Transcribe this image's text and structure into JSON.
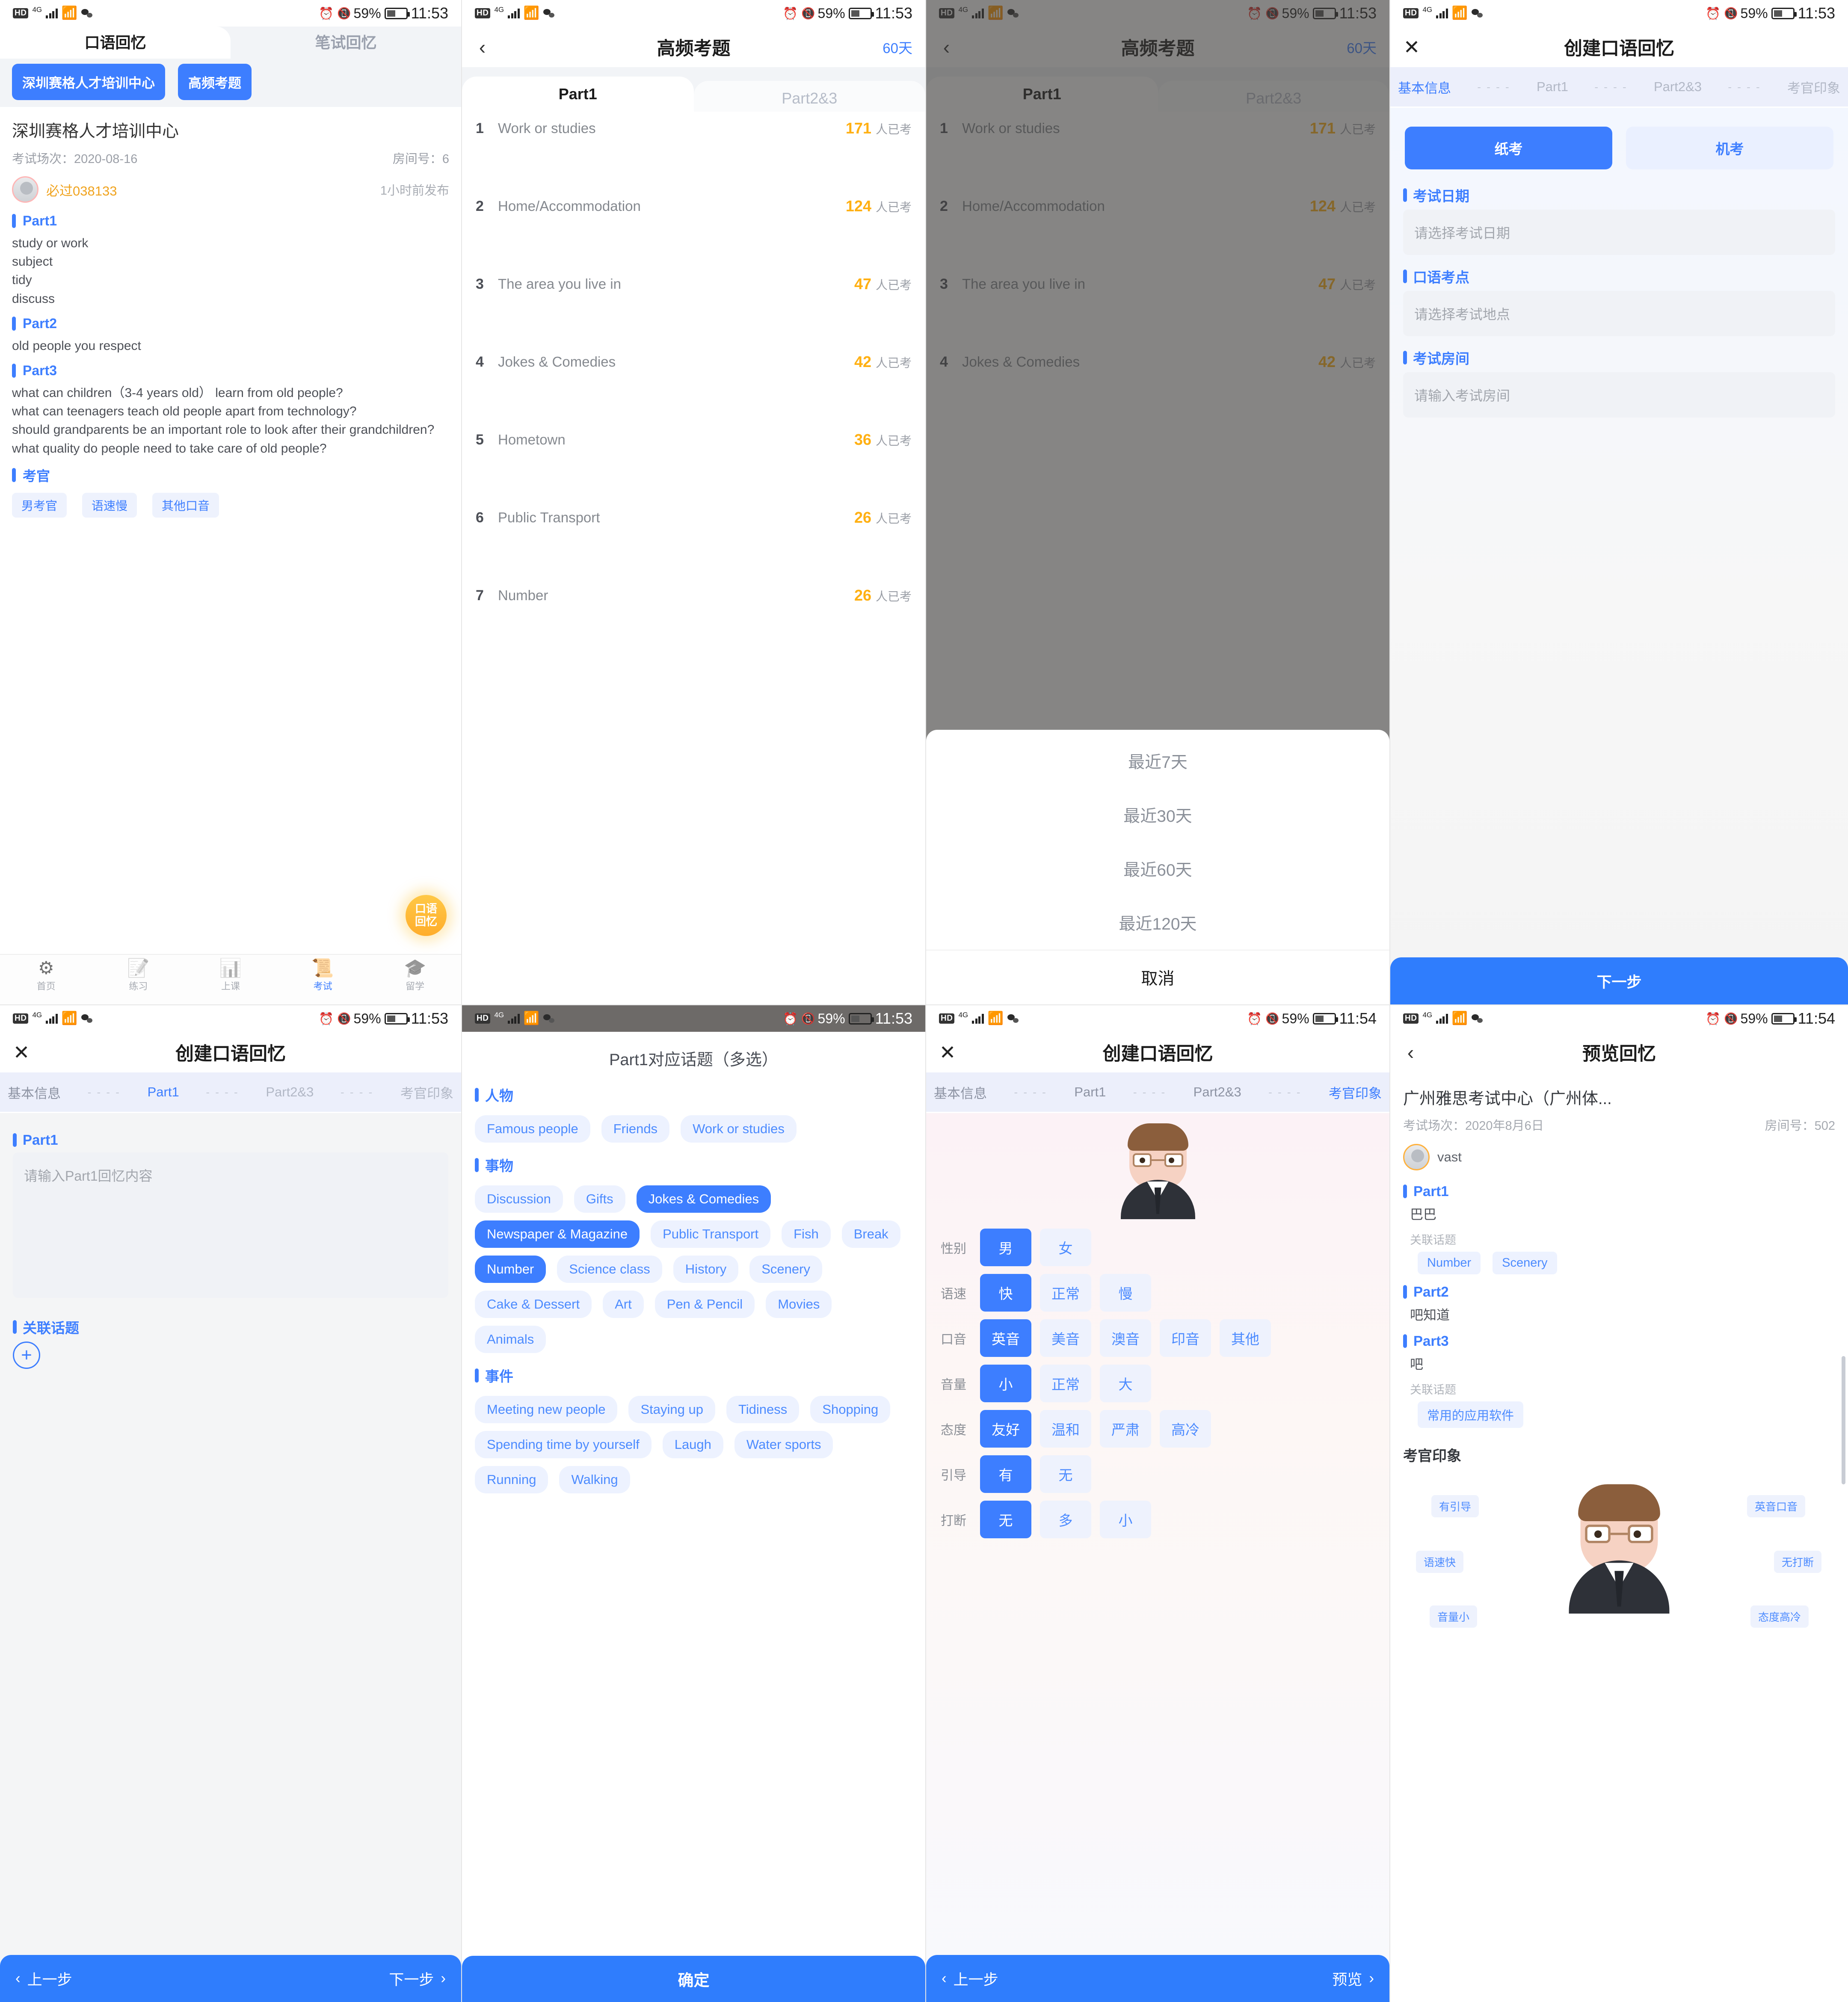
{
  "status_bar": {
    "hd": "HD",
    "net": "4G",
    "battery_pct": "59%",
    "time_1": "11:53",
    "time_2": "11:54"
  },
  "colors": {
    "primary": "#3d7eff",
    "accent_orange": "#ffb013",
    "chip_bg": "#edf2ff"
  },
  "panel1": {
    "tabs": [
      {
        "label": "口语回忆",
        "active": true
      },
      {
        "label": "笔试回忆",
        "active": false
      }
    ],
    "filter_chips": [
      "深圳赛格人才培训中心",
      "高频考题"
    ],
    "org_name": "深圳赛格人才培训中心",
    "exam_session_label": "考试场次：2020-08-16",
    "room_label": "房间号：6",
    "user_name": "必过038133",
    "publish_time": "1小时前发布",
    "sections": [
      {
        "title": "Part1",
        "lines": [
          "study or work",
          "subject",
          "tidy",
          "discuss"
        ]
      },
      {
        "title": "Part2",
        "lines": [
          "old people you respect"
        ]
      },
      {
        "title": "Part3",
        "lines": [
          "what can children（3-4 years old） learn from old people?",
          "what can teenagers teach old people apart from technology?",
          "should grandparents be an important role to look after their grandchildren?",
          "what quality do people need to take care of old people?"
        ]
      },
      {
        "title": "考官",
        "lines": []
      }
    ],
    "examiner_tags": [
      "男考官",
      "语速慢",
      "其他口音"
    ],
    "fab_label": "口语\n回忆",
    "tabbar": [
      {
        "icon": "⚙",
        "label": "首页",
        "active": false
      },
      {
        "icon": "📝",
        "label": "练习",
        "active": false
      },
      {
        "icon": "📊",
        "label": "上课",
        "active": false
      },
      {
        "icon": "📜",
        "label": "考试",
        "active": true
      },
      {
        "icon": "🎓",
        "label": "留学",
        "active": false
      }
    ]
  },
  "panel2": {
    "nav_title": "高频考题",
    "nav_right": "60天",
    "tabs": [
      {
        "label": "Part1",
        "active": true
      },
      {
        "label": "Part2&3",
        "active": false
      }
    ],
    "unit": "人已考",
    "rows": [
      {
        "idx": "1",
        "name": "Work or studies",
        "count": "171"
      },
      {
        "idx": "2",
        "name": "Home/Accommodation",
        "count": "124"
      },
      {
        "idx": "3",
        "name": "The area you live in",
        "count": "47"
      },
      {
        "idx": "4",
        "name": "Jokes & Comedies",
        "count": "42"
      },
      {
        "idx": "5",
        "name": "Hometown",
        "count": "36"
      },
      {
        "idx": "6",
        "name": "Public Transport",
        "count": "26"
      },
      {
        "idx": "7",
        "name": "Number",
        "count": "26"
      }
    ]
  },
  "panel3": {
    "nav_title": "高频考题",
    "nav_right": "60天",
    "tabs": [
      {
        "label": "Part1",
        "active": true
      },
      {
        "label": "Part2&3",
        "active": false
      }
    ],
    "unit": "人已考",
    "rows": [
      {
        "idx": "1",
        "name": "Work or studies",
        "count": "171"
      },
      {
        "idx": "2",
        "name": "Home/Accommodation",
        "count": "124"
      },
      {
        "idx": "3",
        "name": "The area you live in",
        "count": "47"
      },
      {
        "idx": "4",
        "name": "Jokes & Comedies",
        "count": "42"
      }
    ],
    "sheet_options": [
      "最近7天",
      "最近30天",
      "最近60天",
      "最近120天"
    ],
    "sheet_cancel": "取消"
  },
  "panel4": {
    "nav_title": "创建口语回忆",
    "steps": [
      {
        "label": "基本信息",
        "state": "active"
      },
      {
        "label": "Part1",
        "state": "idle"
      },
      {
        "label": "Part2&3",
        "state": "idle"
      },
      {
        "label": "考官印象",
        "state": "idle"
      }
    ],
    "exam_type": [
      {
        "label": "纸考",
        "on": true
      },
      {
        "label": "机考",
        "on": false
      }
    ],
    "fields": [
      {
        "label": "考试日期",
        "placeholder": "请选择考试日期"
      },
      {
        "label": "口语考点",
        "placeholder": "请选择考试地点"
      },
      {
        "label": "考试房间",
        "placeholder": "请输入考试房间"
      }
    ],
    "next_label": "下一步"
  },
  "panel5": {
    "nav_title": "创建口语回忆",
    "steps": [
      {
        "label": "基本信息",
        "state": "done"
      },
      {
        "label": "Part1",
        "state": "active"
      },
      {
        "label": "Part2&3",
        "state": "idle"
      },
      {
        "label": "考官印象",
        "state": "idle"
      }
    ],
    "section_label": "Part1",
    "textarea_placeholder": "请输入Part1回忆内容",
    "related_label": "关联话题",
    "add_icon": "+",
    "prev_label": "上一步",
    "next_label": "下一步"
  },
  "panel6": {
    "title": "Part1对应话题（多选）",
    "groups": [
      {
        "name": "人物",
        "chips": [
          {
            "label": "Famous people",
            "sel": false
          },
          {
            "label": "Friends",
            "sel": false
          },
          {
            "label": "Work or studies",
            "sel": false
          }
        ]
      },
      {
        "name": "事物",
        "chips": [
          {
            "label": "Discussion",
            "sel": false
          },
          {
            "label": "Gifts",
            "sel": false
          },
          {
            "label": "Jokes & Comedies",
            "sel": true
          },
          {
            "label": "Newspaper & Magazine",
            "sel": true
          },
          {
            "label": "Public Transport",
            "sel": false
          },
          {
            "label": "Fish",
            "sel": false
          },
          {
            "label": "Break",
            "sel": false
          },
          {
            "label": "Number",
            "sel": true
          },
          {
            "label": "Science class",
            "sel": false
          },
          {
            "label": "History",
            "sel": false
          },
          {
            "label": "Scenery",
            "sel": false
          },
          {
            "label": "Cake & Dessert",
            "sel": false
          },
          {
            "label": "Art",
            "sel": false
          },
          {
            "label": "Pen & Pencil",
            "sel": false
          },
          {
            "label": "Movies",
            "sel": false
          },
          {
            "label": "Animals",
            "sel": false
          }
        ]
      },
      {
        "name": "事件",
        "chips": [
          {
            "label": "Meeting new people",
            "sel": false
          },
          {
            "label": "Staying up",
            "sel": false
          },
          {
            "label": "Tidiness",
            "sel": false
          },
          {
            "label": "Shopping",
            "sel": false
          },
          {
            "label": "Spending time by yourself",
            "sel": false
          },
          {
            "label": "Laugh",
            "sel": false
          },
          {
            "label": "Water sports",
            "sel": false
          },
          {
            "label": "Running",
            "sel": false
          },
          {
            "label": "Walking",
            "sel": false
          }
        ]
      }
    ],
    "confirm_label": "确定"
  },
  "panel7": {
    "nav_title": "创建口语回忆",
    "steps": [
      {
        "label": "基本信息",
        "state": "done"
      },
      {
        "label": "Part1",
        "state": "done"
      },
      {
        "label": "Part2&3",
        "state": "done"
      },
      {
        "label": "考官印象",
        "state": "active"
      }
    ],
    "rows": [
      {
        "key": "性别",
        "opts": [
          {
            "l": "男",
            "on": true
          },
          {
            "l": "女",
            "on": false
          }
        ]
      },
      {
        "key": "语速",
        "opts": [
          {
            "l": "快",
            "on": true
          },
          {
            "l": "正常",
            "on": false
          },
          {
            "l": "慢",
            "on": false
          }
        ]
      },
      {
        "key": "口音",
        "opts": [
          {
            "l": "英音",
            "on": true
          },
          {
            "l": "美音",
            "on": false
          },
          {
            "l": "澳音",
            "on": false
          },
          {
            "l": "印音",
            "on": false
          },
          {
            "l": "其他",
            "on": false
          }
        ]
      },
      {
        "key": "音量",
        "opts": [
          {
            "l": "小",
            "on": true
          },
          {
            "l": "正常",
            "on": false
          },
          {
            "l": "大",
            "on": false
          }
        ]
      },
      {
        "key": "态度",
        "opts": [
          {
            "l": "友好",
            "on": true
          },
          {
            "l": "温和",
            "on": false
          },
          {
            "l": "严肃",
            "on": false
          },
          {
            "l": "高冷",
            "on": false
          }
        ]
      },
      {
        "key": "引导",
        "opts": [
          {
            "l": "有",
            "on": true
          },
          {
            "l": "无",
            "on": false
          }
        ]
      },
      {
        "key": "打断",
        "opts": [
          {
            "l": "无",
            "on": true
          },
          {
            "l": "多",
            "on": false
          },
          {
            "l": "小",
            "on": false
          }
        ]
      }
    ],
    "prev_label": "上一步",
    "next_label": "预览"
  },
  "panel8": {
    "nav_title": "预览回忆",
    "center_name": "广州雅思考试中心（广州体...",
    "exam_session_label": "考试场次：2020年8月6日",
    "room_label": "房间号：502",
    "user_name": "vast",
    "part1": {
      "title": "Part1",
      "text": "巴巴",
      "related_label": "关联话题",
      "chips": [
        "Number",
        "Scenery"
      ]
    },
    "part2": {
      "title": "Part2",
      "text": "吧知道"
    },
    "part3": {
      "title": "Part3",
      "text": "吧",
      "related_label": "关联话题",
      "chips": [
        "常用的应用软件"
      ]
    },
    "impression_title": "考官印象",
    "impression_labels": [
      "有引导",
      "英音口音",
      "语速快",
      "无打断",
      "音量小",
      "态度高冷"
    ]
  }
}
